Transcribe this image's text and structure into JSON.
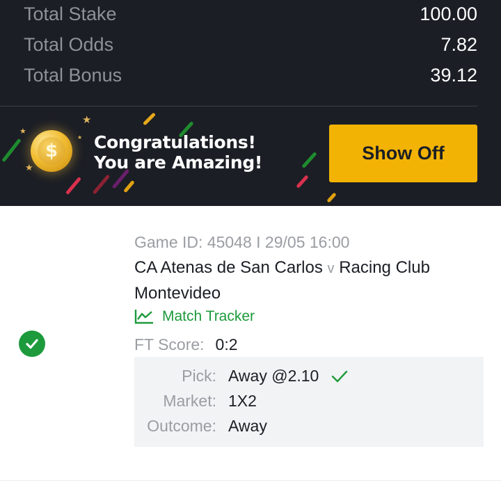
{
  "summary": {
    "total_stake_label": "Total Stake",
    "total_stake_value": "100.00",
    "total_odds_label": "Total Odds",
    "total_odds_value": "7.82",
    "total_bonus_label": "Total Bonus",
    "total_bonus_value": "39.12"
  },
  "banner": {
    "line1": "Congratulations!",
    "line2": "You are Amazing!",
    "coin_symbol": "$",
    "show_off_label": "Show Off",
    "button_color": "#f3b304"
  },
  "bet": {
    "status_icon": "check-circle-icon",
    "status_color": "#1d9a3c",
    "game_id": "Game ID: 45048 I 29/05 16:00",
    "home_team": "CA Atenas de San Carlos",
    "vs": "v",
    "away_team": "Racing Club Montevideo",
    "match_tracker_label": "Match Tracker",
    "ft_score_label": "FT Score:",
    "ft_score_value": "0:2",
    "pick_label": "Pick:",
    "pick_value": "Away @2.10",
    "market_label": "Market:",
    "market_value": "1X2",
    "outcome_label": "Outcome:",
    "outcome_value": "Away"
  }
}
